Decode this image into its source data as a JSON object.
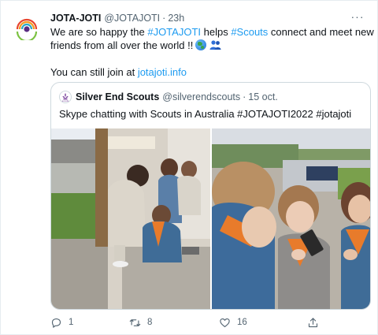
{
  "tweet": {
    "author_name": "JOTA-JOTI",
    "author_handle": "@JOTAJOTI",
    "separator": "·",
    "time": "23h",
    "more_label": "···",
    "line1_prefix": "We are so happy the ",
    "line1_hashtag1": "#JOTAJOTI",
    "line1_middle": " helps ",
    "line1_hashtag2": "#Scouts",
    "line1_suffix": " connect and meet new",
    "line2": "friends from all over the world !!",
    "line3_prefix": "You can still join at ",
    "line3_link": "jotajoti.info",
    "emojis": [
      "globe-icon",
      "people-icon"
    ]
  },
  "quoted": {
    "name": "Silver End Scouts",
    "handle": "@silverendscouts",
    "separator": "·",
    "time": "15 oct.",
    "text": "Skype chatting with Scouts in Australia #JOTAJOTI2022 #jotajoti",
    "photos": [
      "scouts-at-doorway-photo",
      "scouts-looking-at-phone-photo"
    ]
  },
  "actions": {
    "reply_count": "1",
    "retweet_count": "8",
    "like_count": "16"
  },
  "colors": {
    "link": "#1d9bf0",
    "text": "#0f1419",
    "muted": "#536471",
    "border": "#cfd9de"
  }
}
